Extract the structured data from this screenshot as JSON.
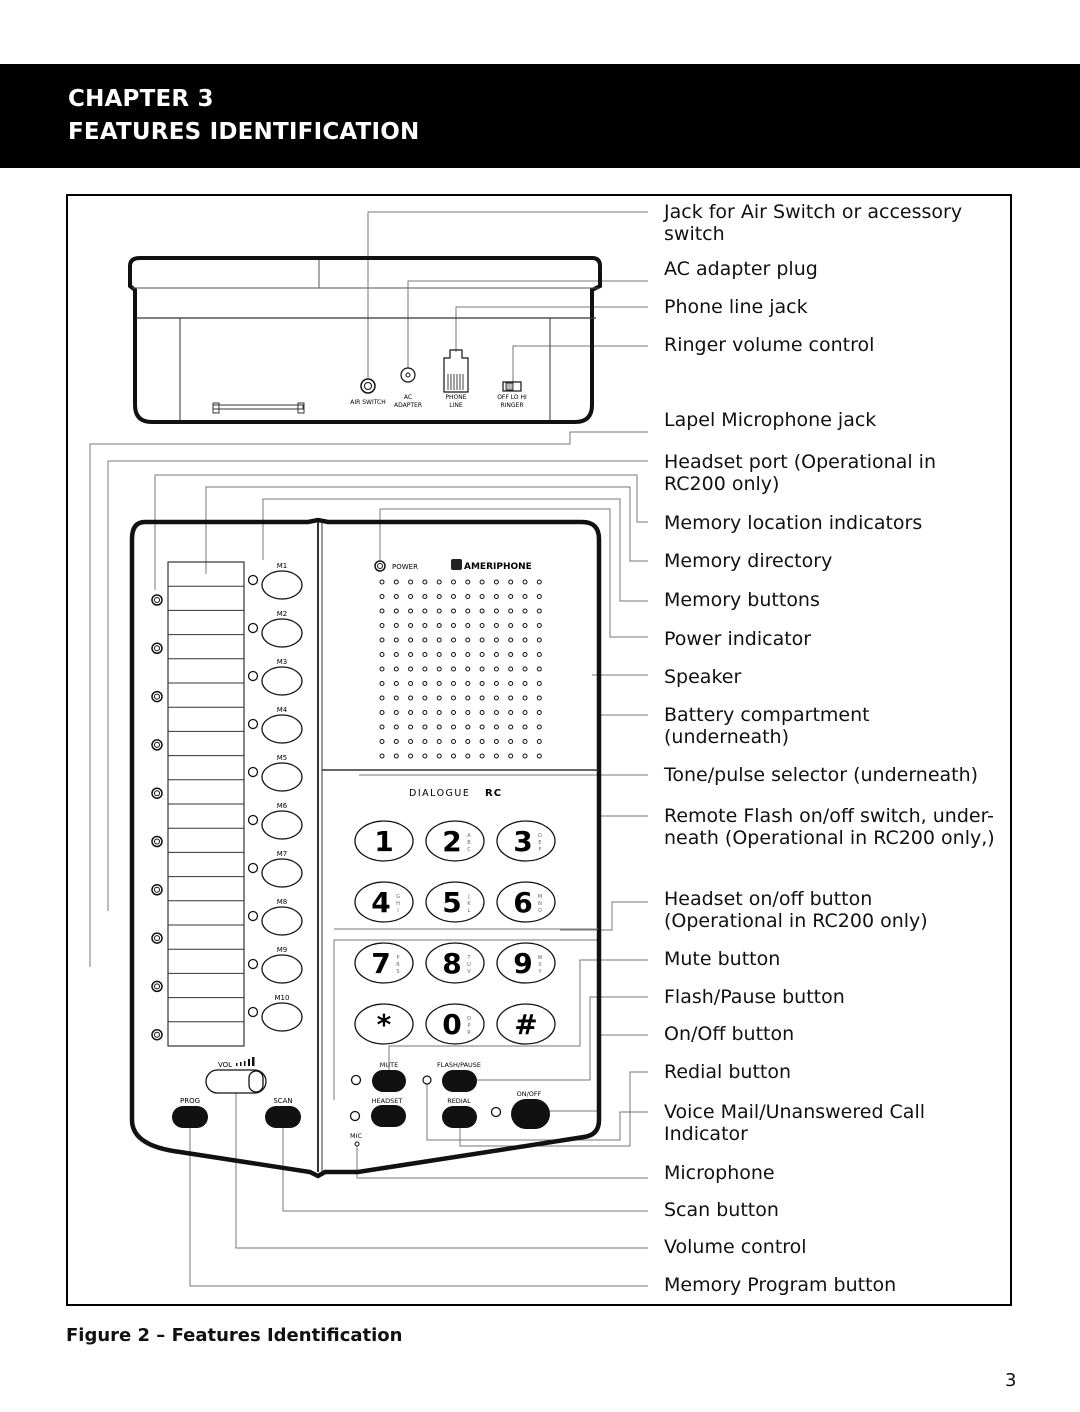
{
  "header": {
    "chapter": "CHAPTER 3",
    "title": "FEATURES IDENTIFICATION"
  },
  "back_panel": {
    "jacks": [
      {
        "id": "air-switch",
        "label": "AIR SWITCH"
      },
      {
        "id": "ac-adapter",
        "label_top": "AC",
        "label_bottom": "ADAPTER"
      },
      {
        "id": "phone-line",
        "label_top": "PHONE",
        "label_bottom": "LINE"
      },
      {
        "id": "ringer",
        "label_top": "OFF LO HI",
        "label_bottom": "RINGER"
      }
    ]
  },
  "front_panel": {
    "power_label": "POWER",
    "brand": "AMERIPHONE",
    "model_prefix": "DIALOGUE",
    "model_suffix": "RC",
    "memory_buttons": [
      "M1",
      "M2",
      "M3",
      "M4",
      "M5",
      "M6",
      "M7",
      "M8",
      "M9",
      "M10"
    ],
    "volume_label": "VOL",
    "prog_label": "PROG",
    "scan_label": "SCAN",
    "mute_label": "MUTE",
    "flash_label": "FLASH/PAUSE",
    "headset_label": "HEADSET",
    "redial_label": "REDIAL",
    "onoff_label": "ON/OFF",
    "mic_label": "MIC",
    "keypad": [
      {
        "digit": "1",
        "letters": ""
      },
      {
        "digit": "2",
        "letters": "ABC"
      },
      {
        "digit": "3",
        "letters": "DEF"
      },
      {
        "digit": "4",
        "letters": "GHI"
      },
      {
        "digit": "5",
        "letters": "JKL"
      },
      {
        "digit": "6",
        "letters": "MNO"
      },
      {
        "digit": "7",
        "letters": "PRS"
      },
      {
        "digit": "8",
        "letters": "TUV"
      },
      {
        "digit": "9",
        "letters": "WXY"
      },
      {
        "digit": "*",
        "letters": ""
      },
      {
        "digit": "0",
        "letters": "OPR"
      },
      {
        "digit": "#",
        "letters": ""
      }
    ]
  },
  "callouts": [
    "Jack for Air Switch or accessory\nswitch",
    "AC adapter plug",
    "Phone line jack",
    "Ringer volume control",
    "Lapel Microphone jack",
    "Headset port (Operational in\nRC200 only)",
    "Memory location indicators",
    "Memory directory",
    "Memory buttons",
    "Power indicator",
    "Speaker",
    "Battery compartment\n(underneath)",
    "Tone/pulse selector (underneath)",
    "Remote Flash on/off switch, under-\nneath (Operational in RC200 only,)",
    "Headset on/off button\n(Operational in RC200 only)",
    "Mute button",
    "Flash/Pause button",
    "On/Off button",
    "Redial button",
    "Voice Mail/Unanswered Call\nIndicator",
    "Microphone",
    "Scan button",
    "Volume control",
    "Memory Program button"
  ],
  "caption": "Figure 2 – Features Identification",
  "page_number": "3"
}
